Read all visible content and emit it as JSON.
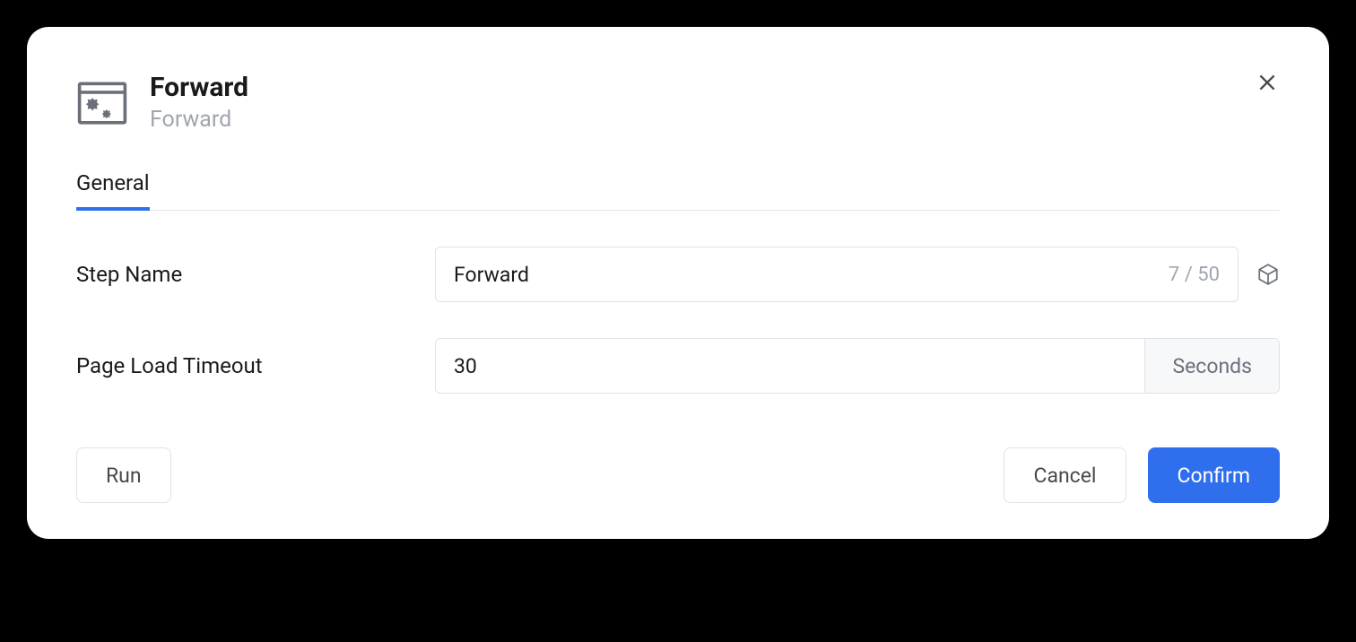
{
  "dialog": {
    "title": "Forward",
    "subtitle": "Forward"
  },
  "tabs": {
    "general": "General"
  },
  "form": {
    "stepNameLabel": "Step Name",
    "stepNameValue": "Forward",
    "stepNameCount": "7 / 50",
    "pageLoadTimeoutLabel": "Page Load Timeout",
    "pageLoadTimeoutValue": "30",
    "pageLoadTimeoutUnit": "Seconds"
  },
  "footer": {
    "run": "Run",
    "cancel": "Cancel",
    "confirm": "Confirm"
  }
}
